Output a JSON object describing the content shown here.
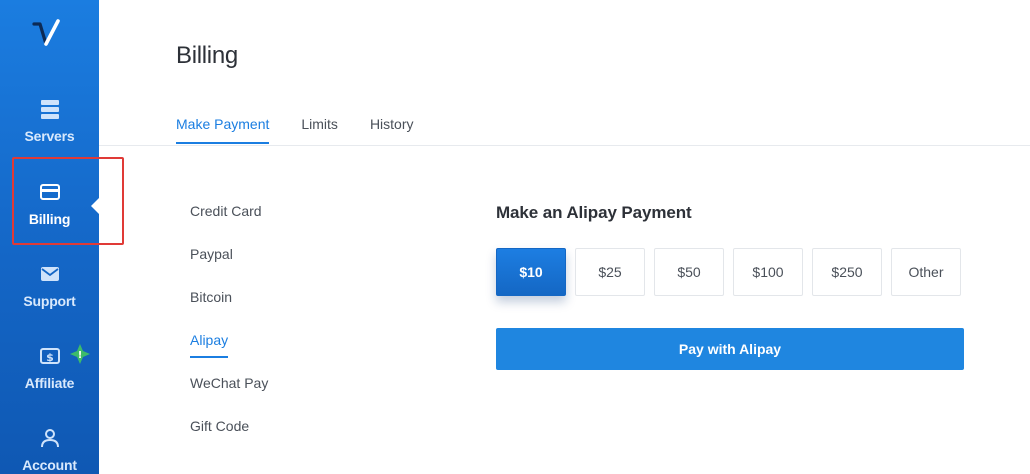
{
  "sidebar": {
    "items": [
      {
        "label": "Servers",
        "icon": "servers-icon"
      },
      {
        "label": "Billing",
        "icon": "credit-card-icon",
        "active": true
      },
      {
        "label": "Support",
        "icon": "envelope-icon"
      },
      {
        "label": "Affiliate",
        "icon": "dollar-bill-icon"
      },
      {
        "label": "Account",
        "icon": "user-icon"
      }
    ],
    "affiliate_badge": "!"
  },
  "header": {
    "title": "Billing",
    "tabs": [
      {
        "label": "Make Payment",
        "active": true
      },
      {
        "label": "Limits"
      },
      {
        "label": "History"
      }
    ]
  },
  "payment_methods": [
    {
      "label": "Credit Card"
    },
    {
      "label": "Paypal"
    },
    {
      "label": "Bitcoin"
    },
    {
      "label": "Alipay",
      "active": true
    },
    {
      "label": "WeChat Pay"
    },
    {
      "label": "Gift Code"
    }
  ],
  "panel": {
    "title": "Make an Alipay Payment",
    "amounts": [
      "$10",
      "$25",
      "$50",
      "$100",
      "$250",
      "Other"
    ],
    "selected_amount": "$10",
    "pay_button": "Pay with Alipay"
  },
  "colors": {
    "accent": "#1b7ee1",
    "sidebar": "#1466c6",
    "highlight": "#e03a36",
    "badge": "#3dbb6a"
  }
}
